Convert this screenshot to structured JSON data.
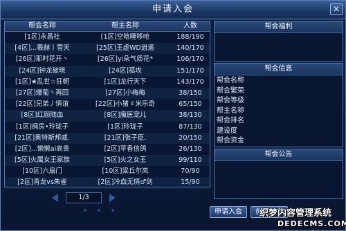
{
  "dialog": {
    "title": "申请入会",
    "close_glyph": "×"
  },
  "guild_list": {
    "columns": [
      "帮会名称",
      "帮主名称",
      "人数"
    ],
    "rows": [
      [
        "[1区]永昌社",
        "[1区]空晗瞳哆呛",
        "188/190"
      ],
      [
        "[4区]...羲赫丨雪天",
        "[25区]王虚WD逍遥",
        "140/170"
      ],
      [
        "[26区]耶时花开丶",
        "[26区]yi朵气质花*",
        "106/170"
      ],
      [
        "[24区]钟龙破晓",
        "[24区]孤攻",
        "151/170"
      ],
      [
        "[1区]★乱世☆狂朝",
        "[1区]龙行天下",
        "143/170"
      ],
      [
        "[27区]爆菊丶再回",
        "[27区]小梅梅",
        "38/150"
      ],
      [
        "[22区]兄弟丿情谊",
        "[22区]小猪ゞ米乐奇",
        "65/150"
      ],
      [
        "[8区]红颜随血",
        "[8区]魔医宠儿",
        "38/130"
      ],
      [
        "[1区]闽房•玲珑子",
        "[1区]玲珑子",
        "87/130"
      ],
      [
        "[21区]奥特斯邦威.",
        "[21区]张子臣.",
        "20/150"
      ],
      [
        "[2区]...懒懒ai高贵",
        "[2区]苹香信鸽",
        "26/130"
      ],
      [
        "[5区]火属女王家族",
        "[5区]火之女王",
        "99/110"
      ],
      [
        "[10区]六扇门",
        "[10区]梁丘尔岚",
        "70/90"
      ],
      [
        "[2区]青龙vs朱雀",
        "[2区]冷血无情♂剑",
        "15/90"
      ]
    ]
  },
  "welfare": {
    "title": "帮会福利"
  },
  "info": {
    "title": "帮会信息",
    "items": [
      "帮会名称",
      "帮会繁荣",
      "帮会等级",
      "帮主名称",
      "帮会排名",
      "建设度",
      "帮会资金"
    ]
  },
  "notice": {
    "title": "帮会公告"
  },
  "pager": {
    "text": "1/3"
  },
  "buttons": {
    "join": "申请入会",
    "create": "创建帮会"
  },
  "watermark": {
    "line1": "织梦内容管理系统",
    "line2": "DEDECMS.COM"
  }
}
